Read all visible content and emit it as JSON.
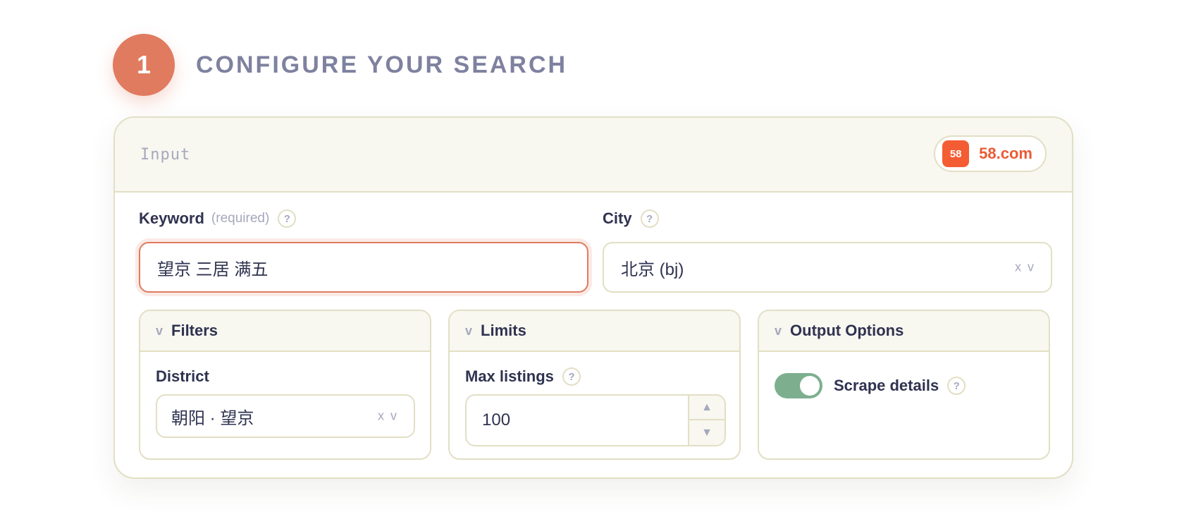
{
  "step": {
    "number": "1",
    "title": "CONFIGURE YOUR SEARCH"
  },
  "card": {
    "header_label": "Input",
    "source": {
      "icon_text": "58",
      "name": "58.com",
      "color": "#f45d34"
    }
  },
  "keyword": {
    "label": "Keyword",
    "sub_label": "(required)",
    "help": "?",
    "value": "望京 三居 满五"
  },
  "city": {
    "label": "City",
    "help": "?",
    "value": "北京 (bj)",
    "controls": "x v"
  },
  "panels": {
    "filters": {
      "chevron": "v",
      "title": "Filters",
      "district": {
        "label": "District",
        "value": "朝阳 · 望京",
        "controls": "x v"
      }
    },
    "limits": {
      "chevron": "v",
      "title": "Limits",
      "max_listings": {
        "label": "Max listings",
        "help": "?",
        "value": "100",
        "up": "▲",
        "down": "▼"
      }
    },
    "output": {
      "chevron": "v",
      "title": "Output Options",
      "scrape_details": {
        "label": "Scrape details",
        "help": "?",
        "enabled": true
      }
    }
  },
  "colors": {
    "accent": "#e07b5f",
    "toggle_on": "#7daf8f",
    "border": "#e2dfc4"
  }
}
